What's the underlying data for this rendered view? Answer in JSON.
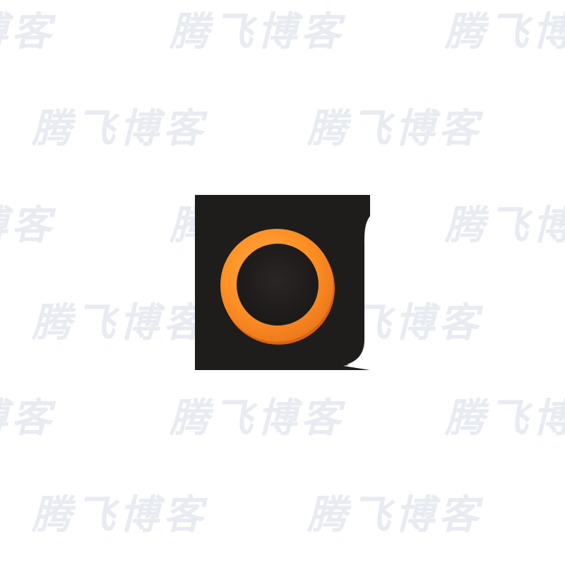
{
  "watermark": {
    "text": "腾飞博客",
    "color": "#e6e9f0"
  },
  "logo": {
    "icon": "orange-ring-logo-icon",
    "tile_color": "#1f1c1c",
    "ring_color": "#ff9125",
    "ring_shadow_color": "#d9640f",
    "inner_color": "#221f1f"
  }
}
